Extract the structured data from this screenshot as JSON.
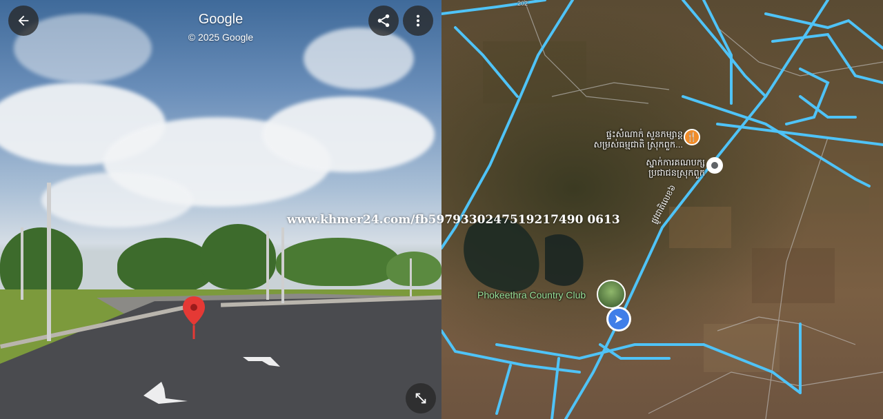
{
  "street_view": {
    "title": "Google",
    "copyright": "© 2025 Google",
    "back_button": "back-arrow-icon",
    "share_button": "share-icon",
    "more_button": "more-vertical-icon",
    "expand_button": "expand-icon",
    "marker_color": "#e53935"
  },
  "map": {
    "road_number": "202",
    "poi_restaurant_label_line1": "ផ្ទះសំណាក់ សួនកម្សាន្ត",
    "poi_restaurant_label_line2": "សម្រស់ធម្មជាតិ ស្រុកពួក...",
    "poi_office_label_line1": "ស្នាក់ការគណបក្ស",
    "poi_office_label_line2": "ប្រជាជនស្រុកពួក",
    "road_name": "ផ្លូវជាតិលេខ៦",
    "club_label": "Phokeethra Country Club",
    "road_color": "#4fc3f7",
    "restaurant_icon": "restaurant-icon",
    "location_icon": "navigation-arrow-icon"
  },
  "watermark": "www.khmer24.com/fb5979330247519217490 0613"
}
